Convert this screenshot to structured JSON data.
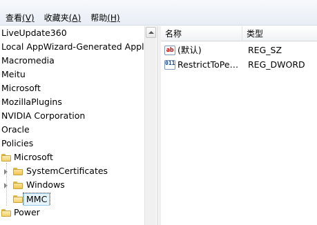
{
  "menubar": {
    "items": [
      {
        "text": "查看",
        "acc": "(V)"
      },
      {
        "text": "收藏夹",
        "acc": "(A)"
      },
      {
        "text": "帮助",
        "acc": "(H)"
      }
    ]
  },
  "tree": {
    "items": [
      {
        "label": "LiveUpdate360"
      },
      {
        "label": "Local AppWizard-Generated Applications"
      },
      {
        "label": "Macromedia"
      },
      {
        "label": "Meitu"
      },
      {
        "label": "Microsoft"
      },
      {
        "label": "MozillaPlugins"
      },
      {
        "label": "NVIDIA Corporation"
      },
      {
        "label": "Oracle"
      },
      {
        "label": "Policies"
      },
      {
        "label": "Microsoft"
      },
      {
        "label": "SystemCertificates"
      },
      {
        "label": "Windows"
      },
      {
        "label": "MMC"
      },
      {
        "label": "Power"
      }
    ]
  },
  "list": {
    "headers": {
      "name": "名称",
      "type": "类型"
    },
    "rows": [
      {
        "icon": "string-value-icon",
        "icon_text": "ab",
        "name": "(默认)",
        "type": "REG_SZ"
      },
      {
        "icon": "dword-value-icon",
        "icon_text": "011",
        "name": "RestrictToPermittedSnapins",
        "type": "REG_DWORD"
      }
    ]
  }
}
